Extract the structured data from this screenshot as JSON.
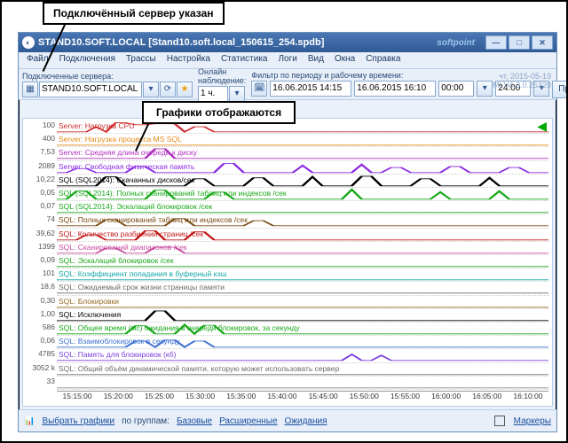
{
  "annotations": {
    "connected": "Подключённый сервер указан",
    "charts": "Графики отображаются"
  },
  "window": {
    "title": "STAND10.SOFT.LOCAL  [Stand10.soft.local_150615_254.spdb]",
    "brand": "softpoint",
    "dateText": "чт, 2015-05-19",
    "version": "MI V4.3.0.25320"
  },
  "menu": [
    "Файл",
    "Подключения",
    "Трассы",
    "Настройка",
    "Статистика",
    "Логи",
    "Вид",
    "Окна",
    "Справка"
  ],
  "toolbar": {
    "connectedLabel": "Подключенные сервера:",
    "server": "STAND10.SOFT.LOCAL",
    "onlineLabel": "Онлайн наблюдение:",
    "onlineValue": "1 ч.",
    "filterLabel": "Фильтр по периоду и рабочему времени:",
    "from": "16.06.2015 14:15",
    "to": "16.06.2015 16:10",
    "timeFrom": "00:00",
    "timeTo": "24:00",
    "apply": "Применить"
  },
  "footer": {
    "choose": "Выбрать графики",
    "groupsLabel": "по группам:",
    "groups": [
      "Базовые",
      "Расширенные",
      "Ожидания"
    ],
    "markers": "Маркеры"
  },
  "chart_data": {
    "type": "line",
    "x": [
      "15:15:00",
      "15:20:00",
      "15:25:00",
      "15:30:00",
      "15:35:00",
      "15:40:00",
      "15:45:00",
      "15:50:00",
      "15:55:00",
      "16:00:00",
      "16:05:00",
      "16:10:00"
    ],
    "y": [
      "100",
      "400",
      "7,53",
      "2089",
      "10,22",
      "0,05",
      "0,07",
      "74",
      "39,62",
      "1399",
      "0,09",
      "101",
      "18,6",
      "0,30",
      "1,00",
      "586",
      "0,06",
      "4785",
      "3052 k",
      "33"
    ],
    "series": [
      {
        "label": "Server: Нагрузка CPU",
        "color": "#cc2a2a",
        "spikes": [
          [
            0.08,
            0.5
          ],
          [
            0.13,
            0.9
          ],
          [
            0.17,
            0.7
          ],
          [
            0.22,
            0.8
          ],
          [
            0.3,
            0.5
          ]
        ]
      },
      {
        "label": "Server: Нагрузка процесса MS SQL",
        "color": "#e58a17",
        "spikes": []
      },
      {
        "label": "Server: Средняя длина очереди к диску",
        "color": "#b02fbf",
        "spikes": [
          [
            0.21,
            0.95
          ]
        ]
      },
      {
        "label": "Server: Свободная физическая память",
        "color": "#8a2be2",
        "spikes": [
          [
            0.05,
            0.4
          ],
          [
            0.18,
            0.6
          ],
          [
            0.35,
            0.9
          ],
          [
            0.5,
            0.7
          ],
          [
            0.62,
            0.8
          ],
          [
            0.7,
            0.5
          ],
          [
            0.8,
            0.6
          ],
          [
            0.92,
            0.5
          ]
        ]
      },
      {
        "label": "SQL (SQL2014): Скачанных дисков/сек",
        "color": "#000000",
        "spikes": [
          [
            0.1,
            0.9
          ],
          [
            0.28,
            0.7
          ],
          [
            0.4,
            0.8
          ],
          [
            0.52,
            0.9
          ],
          [
            0.63,
            0.95
          ],
          [
            0.75,
            0.7
          ],
          [
            0.88,
            0.8
          ]
        ]
      },
      {
        "label": "SQL (SQL2014): Полных сканирований таблиц или индексов /сек",
        "color": "#18a818",
        "spikes": [
          [
            0.06,
            0.8
          ],
          [
            0.2,
            0.9
          ],
          [
            0.33,
            0.7
          ],
          [
            0.6,
            0.95
          ],
          [
            0.78,
            0.7
          ],
          [
            0.9,
            0.8
          ]
        ]
      },
      {
        "label": "SQL (SQL2014): Эскалаций блокировок /сек",
        "color": "#1aa81a",
        "spikes": []
      },
      {
        "label": "SQL: Полных сканирований таблиц или индексов /сек",
        "color": "#7a4a12",
        "spikes": [
          [
            0.12,
            0.6
          ],
          [
            0.25,
            0.7
          ],
          [
            0.41,
            0.5
          ]
        ]
      },
      {
        "label": "SQL: Количество разбиений страниц /сек",
        "color": "#c01616",
        "spikes": [
          [
            0.07,
            0.5
          ],
          [
            0.19,
            0.9
          ],
          [
            0.3,
            0.7
          ],
          [
            0.28,
            0.8
          ]
        ]
      },
      {
        "label": "SQL: Сканирований диапазонов /сек",
        "color": "#c74aa0",
        "spikes": [
          [
            0.1,
            0.5
          ],
          [
            0.22,
            0.6
          ]
        ]
      },
      {
        "label": "SQL: Эскалаций блокировок /сек",
        "color": "#1aa81a",
        "spikes": []
      },
      {
        "label": "SQL: Коэффициент попадания в буферный кэш",
        "color": "#13a5a5",
        "spikes": []
      },
      {
        "label": "SQL: Ожидаемый срок жизни страницы памяти",
        "color": "#6b6b6b",
        "spikes": []
      },
      {
        "label": "SQL: Блокировки",
        "color": "#946b1e",
        "spikes": []
      },
      {
        "label": "SQL: Исключения",
        "color": "#000000",
        "spikes": [
          [
            0.2,
            0.95
          ]
        ]
      },
      {
        "label": "SQL: Общее время (мс) ожидания в очереди блокировок, за секунду",
        "color": "#18a818",
        "spikes": [
          [
            0.18,
            0.8
          ],
          [
            0.26,
            0.9
          ],
          [
            0.31,
            0.85
          ]
        ]
      },
      {
        "label": "SQL: Взаимоблокировок в секунду",
        "color": "#3b6fd1",
        "spikes": [
          [
            0.17,
            0.6
          ],
          [
            0.24,
            0.7
          ],
          [
            0.3,
            0.6
          ]
        ]
      },
      {
        "label": "SQL: Память для блокировок (кб)",
        "color": "#7a3fdc",
        "spikes": [
          [
            0.6,
            0.6
          ],
          [
            0.66,
            0.5
          ]
        ]
      },
      {
        "label": "SQL: Общий объём динамической памяти, которую может использовать сервер",
        "color": "#6b6b6b",
        "spikes": []
      },
      {
        "label": "",
        "color": "#888888",
        "spikes": []
      }
    ]
  }
}
